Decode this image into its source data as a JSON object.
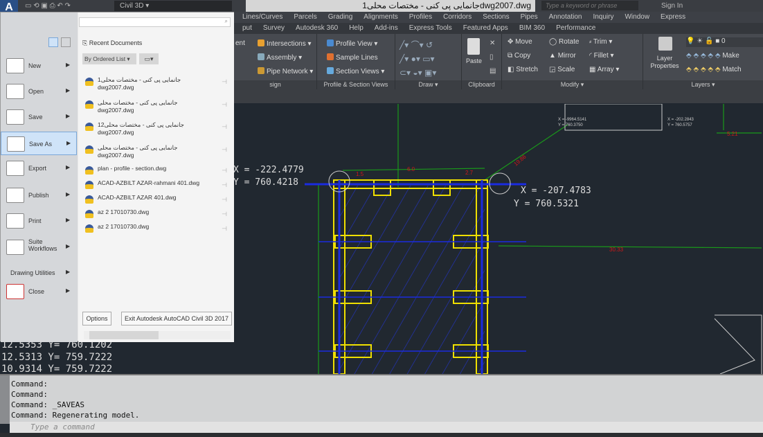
{
  "titlebar": {
    "app_button": "A",
    "workspace": "Civil 3D",
    "title": "جانمایی پی کنی - مختصات محلی1dwg2007.dwg",
    "search_placeholder": "Type a keyword or phrase",
    "sign_in": "Sign In"
  },
  "menu1": [
    "Lines/Curves",
    "Parcels",
    "Grading",
    "Alignments",
    "Profiles",
    "Corridors",
    "Sections",
    "Pipes",
    "Annotation",
    "Inquiry",
    "Window",
    "Express"
  ],
  "menu2": [
    "put",
    "Survey",
    "Autodesk 360",
    "Help",
    "Add-ins",
    "Express Tools",
    "Featured Apps",
    "BIM 360",
    "Performance"
  ],
  "ribbon": {
    "create_design": {
      "items": [
        "ent",
        "Intersections",
        "Assembly",
        "Pipe Network"
      ],
      "title": "sign"
    },
    "profile_section": {
      "items": [
        "Profile View",
        "Sample Lines",
        "Section Views"
      ],
      "title": "Profile & Section Views"
    },
    "draw": {
      "title": "Draw"
    },
    "clipboard": {
      "paste": "Paste",
      "title": "Clipboard"
    },
    "modify": {
      "items": [
        "Move",
        "Rotate",
        "Trim",
        "Copy",
        "Mirror",
        "Fillet",
        "Stretch",
        "Scale",
        "Array"
      ],
      "title": "Modify"
    },
    "layers": {
      "layer_properties": "Layer Properties",
      "current_layer": "0",
      "items": [
        "Make",
        "Match"
      ],
      "title": "Layers"
    }
  },
  "app_menu": {
    "search_placeholder": "",
    "left": [
      {
        "label": "New",
        "icon": "new-icon"
      },
      {
        "label": "Open",
        "icon": "open-icon"
      },
      {
        "label": "Save",
        "icon": "save-icon"
      },
      {
        "label": "Save As",
        "icon": "save-as-icon",
        "selected": true
      },
      {
        "label": "Export",
        "icon": "export-icon"
      },
      {
        "label": "Publish",
        "icon": "publish-icon"
      },
      {
        "label": "Print",
        "icon": "print-icon"
      },
      {
        "label": "Suite Workflows",
        "icon": "suite-workflows-icon"
      },
      {
        "label": "Drawing Utilities",
        "icon": ""
      },
      {
        "label": "Close",
        "icon": "close-icon"
      }
    ],
    "recent_title": "Recent Documents",
    "sort_dropdown": "By Ordered List",
    "documents": [
      [
        "جانمایی پی کنی - مختصات محلی1",
        "dwg2007.dwg"
      ],
      [
        "جانمایی پی کنی - مختصات محلی",
        "dwg2007.dwg"
      ],
      [
        "جانمایی پی کنی - مختصات محلی12",
        "dwg2007.dwg"
      ],
      [
        "جانمایی پی کنی - مختصات محلی",
        "dwg2007.dwg"
      ],
      [
        "plan - profile - section.dwg"
      ],
      [
        "ACAD-AZBILT AZAR-rahmani 401.dwg"
      ],
      [
        "ACAD-AZBILT AZAR 401.dwg"
      ],
      [
        "az 2   17010730.dwg"
      ],
      [
        "az 2   17010730.dwg"
      ]
    ],
    "options_button": "Options",
    "exit_button": "Exit Autodesk AutoCAD Civil 3D 2017"
  },
  "drawing": {
    "point_a": {
      "x": "X  =  -222.4779",
      "y": "Y  =  760.4218"
    },
    "point_b": {
      "x": "X  =  -207.4783",
      "y": "Y  =  760.5321"
    },
    "box_left": [
      "X = -9964.5141",
      "Y = 760.3750"
    ],
    "box_right": [
      "X = -202.2843",
      "Y = 760.5757"
    ],
    "dims": [
      "6.0",
      "5.21",
      "19.86",
      "30.33",
      "1.5",
      "2.7"
    ],
    "coords_behind": [
      "12.5353    Y=  760.1202",
      "12.5313    Y=  759.7222",
      "10.9314    Y=  759.7222"
    ]
  },
  "command": {
    "history": [
      "Command:",
      "Command:",
      "Command:  _SAVEAS",
      "Command:  Regenerating model."
    ],
    "placeholder": "Type a command"
  },
  "colors": {
    "drawing_bg": "#212830",
    "yellow": "#f0e000",
    "blue": "#1a2be0",
    "green": "#19a019",
    "red": "#d01818"
  }
}
